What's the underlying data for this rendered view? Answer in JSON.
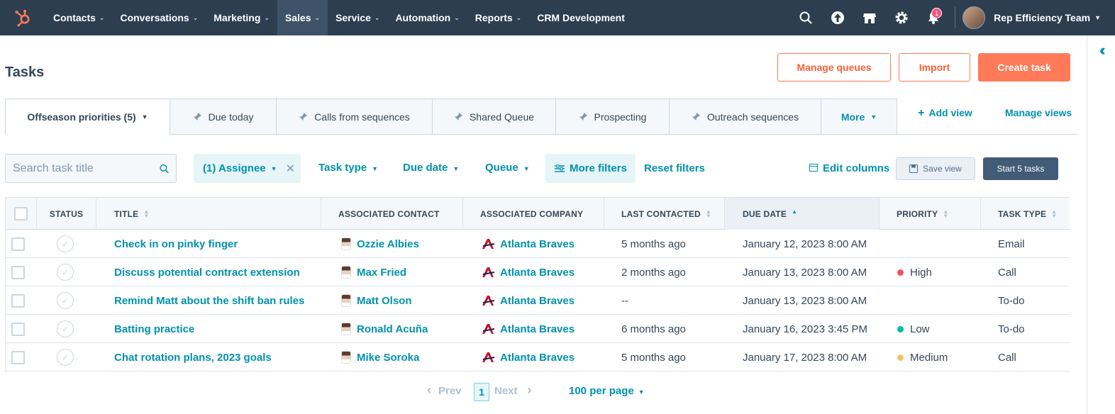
{
  "nav": {
    "items": [
      "Contacts",
      "Conversations",
      "Marketing",
      "Sales",
      "Service",
      "Automation",
      "Reports",
      "CRM Development"
    ],
    "has_caret": [
      true,
      true,
      true,
      true,
      true,
      true,
      true,
      false
    ],
    "active_index": 3,
    "notification_count": "1",
    "account": "Rep Efficiency Team"
  },
  "header": {
    "title": "Tasks",
    "manage_queues": "Manage queues",
    "import": "Import",
    "create_task": "Create task"
  },
  "tabs": {
    "items": [
      "Offseason priorities (5)",
      "Due today",
      "Calls from sequences",
      "Shared Queue",
      "Prospecting",
      "Outreach sequences"
    ],
    "more": "More",
    "add_view": "Add view",
    "manage_views": "Manage views"
  },
  "filters": {
    "search_placeholder": "Search task title",
    "assignee": "(1) Assignee",
    "task_type": "Task type",
    "due_date": "Due date",
    "queue": "Queue",
    "more_filters": "More filters",
    "reset_filters": "Reset filters",
    "edit_columns": "Edit columns",
    "save_view": "Save view",
    "start_tasks": "Start 5 tasks"
  },
  "table": {
    "columns": [
      "STATUS",
      "TITLE",
      "ASSOCIATED CONTACT",
      "ASSOCIATED COMPANY",
      "LAST CONTACTED",
      "DUE DATE",
      "PRIORITY",
      "TASK TYPE"
    ],
    "rows": [
      {
        "title": "Check in on pinky finger",
        "contact": "Ozzie Albies",
        "company": "Atlanta Braves",
        "last_contacted": "5 months ago",
        "due": "January 12, 2023 8:00 AM",
        "priority": "",
        "priority_color": "",
        "type": "Email"
      },
      {
        "title": "Discuss potential contract extension",
        "contact": "Max Fried",
        "company": "Atlanta Braves",
        "last_contacted": "2 months ago",
        "due": "January 13, 2023 8:00 AM",
        "priority": "High",
        "priority_color": "#f2545b",
        "type": "Call"
      },
      {
        "title": "Remind Matt about the shift ban rules",
        "contact": "Matt Olson",
        "company": "Atlanta Braves",
        "last_contacted": "--",
        "due": "January 13, 2023 8:00 AM",
        "priority": "",
        "priority_color": "",
        "type": "To-do"
      },
      {
        "title": "Batting practice",
        "contact": "Ronald Acuña",
        "company": "Atlanta Braves",
        "last_contacted": "6 months ago",
        "due": "January 16, 2023 3:45 PM",
        "priority": "Low",
        "priority_color": "#00bda5",
        "type": "To-do"
      },
      {
        "title": "Chat rotation plans, 2023 goals",
        "contact": "Mike Soroka",
        "company": "Atlanta Braves",
        "last_contacted": "5 months ago",
        "due": "January 17, 2023 8:00 AM",
        "priority": "Medium",
        "priority_color": "#f5c26b",
        "type": "Call"
      }
    ]
  },
  "pagination": {
    "prev": "Prev",
    "page": "1",
    "next": "Next",
    "per_page": "100 per page"
  },
  "colors": {
    "nav_bg": "#2d3e50",
    "accent": "#ff7a59",
    "link": "#0091ae"
  }
}
